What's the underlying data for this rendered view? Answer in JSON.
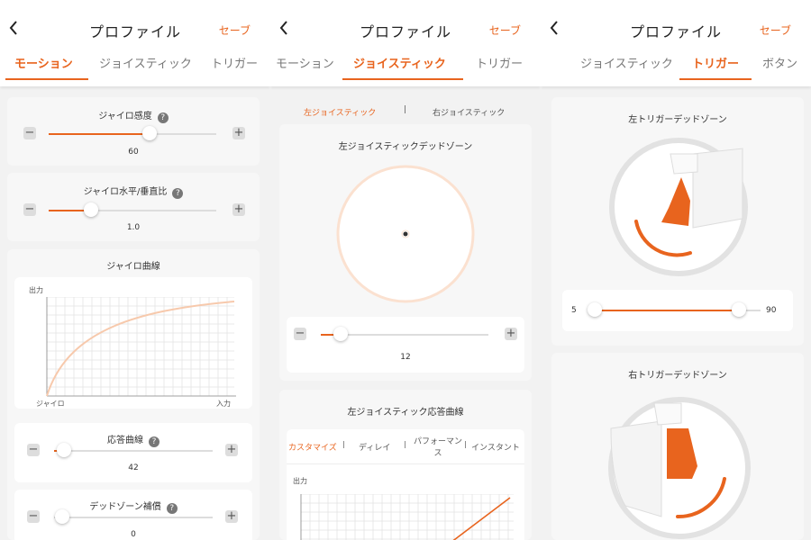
{
  "header": {
    "title": "プロファイル",
    "save_label": "セーブ"
  },
  "tabs": [
    "モーション",
    "ジョイスティック",
    "トリガー",
    "ボタン"
  ],
  "motion": {
    "gyro_sensitivity": {
      "label": "ジャイロ感度",
      "value": "60"
    },
    "gyro_ratio": {
      "label": "ジャイロ水平/垂直比",
      "value": "1.0"
    },
    "gyro_curve": {
      "label": "ジャイロ曲線",
      "y_label": "出力",
      "x_start_label": "ジャイロ",
      "x_end_label": "入力"
    },
    "response_curve": {
      "label": "応答曲線",
      "value": "42"
    },
    "deadzone_comp": {
      "label": "デッドゾーン補償",
      "value": "0"
    }
  },
  "joystick": {
    "left_tab": "左ジョイスティック",
    "separator": "|",
    "right_tab": "右ジョイスティック",
    "deadzone_label": "左ジョイスティックデッドゾーン",
    "deadzone_value": "12",
    "response_label": "左ジョイスティック応答曲線",
    "curve_tabs": [
      "カスタマイズ",
      "ディレイ",
      "パフォーマンス",
      "インスタント"
    ],
    "curve_y_label": "出力"
  },
  "trigger": {
    "left_label": "左トリガーデッドゾーン",
    "left_min": "5",
    "left_max": "90",
    "right_label": "右トリガーデッドゾーン"
  },
  "colors": {
    "accent": "#e8641e",
    "accent_light": "#f7c9ac"
  },
  "icons": {
    "back": "chevron-left-icon",
    "help": "question-circle-icon",
    "minus": "minus-icon",
    "plus": "plus-icon"
  }
}
